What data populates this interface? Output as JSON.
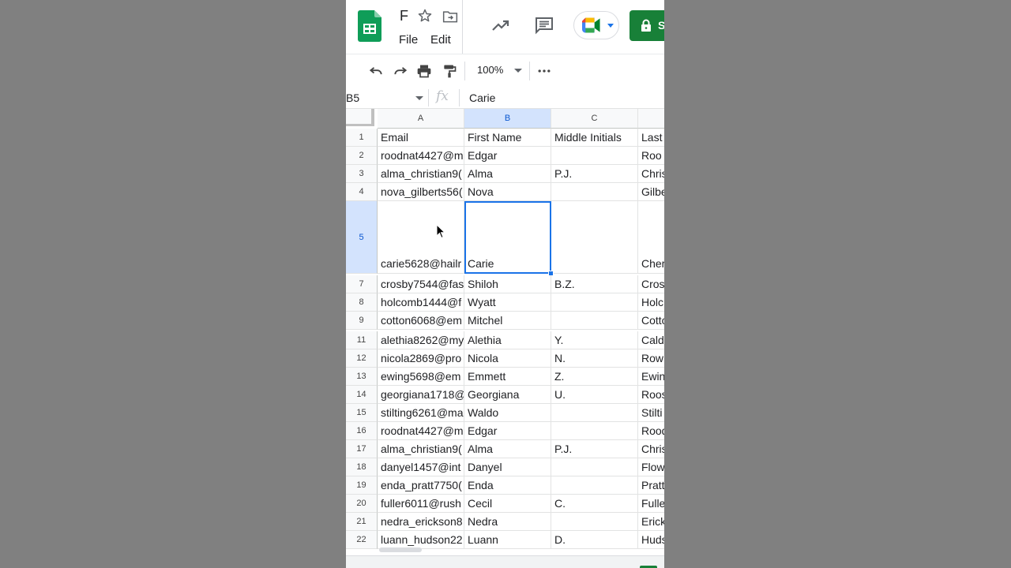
{
  "app": {
    "title_fragment": "F",
    "menus": [
      "File",
      "Edit"
    ],
    "share_label": "S",
    "colors": {
      "brand_green": "#188038",
      "selection_blue": "#1a73e8"
    }
  },
  "toolbar": {
    "zoom": "100%",
    "icons": [
      "undo-icon",
      "redo-icon",
      "print-icon",
      "paint-format-icon",
      "more-icon"
    ]
  },
  "formula_bar": {
    "cell_ref": "B5",
    "fx": "fx",
    "value": "Carie"
  },
  "grid": {
    "columns": [
      "A",
      "B",
      "C"
    ],
    "selected_column": "B",
    "selected_row": "5",
    "rows": [
      {
        "n": "1",
        "a": "Email",
        "b": "First Name",
        "c": "Middle Initials",
        "d": "Last"
      },
      {
        "n": "2",
        "a": "roodnat4427@m",
        "b": "Edgar",
        "c": "",
        "d": "Roo"
      },
      {
        "n": "3",
        "a": "alma_christian9(",
        "b": "Alma",
        "c": "P.J.",
        "d": "Chris"
      },
      {
        "n": "4",
        "a": "nova_gilberts56(",
        "b": "Nova",
        "c": "",
        "d": "Gilbe"
      },
      {
        "n": "5",
        "a": "carie5628@hailr",
        "b": "Carie",
        "c": "",
        "d": "Cher"
      },
      {
        "n": "7",
        "a": "crosby7544@fas",
        "b": "Shiloh",
        "c": "B.Z.",
        "d": "Cros"
      },
      {
        "n": "8",
        "a": "holcomb1444@f",
        "b": "Wyatt",
        "c": "",
        "d": "Holc"
      },
      {
        "n": "9",
        "a": "cotton6068@em",
        "b": "Mitchel",
        "c": "",
        "d": "Cotto"
      },
      {
        "n": "11",
        "a": "alethia8262@my",
        "b": "Alethia",
        "c": "Y.",
        "d": "Cald"
      },
      {
        "n": "12",
        "a": "nicola2869@pro",
        "b": "Nicola",
        "c": "N.",
        "d": "Row"
      },
      {
        "n": "13",
        "a": "ewing5698@em",
        "b": "Emmett",
        "c": "Z.",
        "d": "Ewin"
      },
      {
        "n": "14",
        "a": "georgiana1718@",
        "b": "Georgiana",
        "c": "U.",
        "d": "Roos"
      },
      {
        "n": "15",
        "a": "stilting6261@ma",
        "b": "Waldo",
        "c": "",
        "d": "Stilti"
      },
      {
        "n": "16",
        "a": "roodnat4427@m",
        "b": "Edgar",
        "c": "",
        "d": "Rood"
      },
      {
        "n": "17",
        "a": "alma_christian9(",
        "b": "Alma",
        "c": "P.J.",
        "d": "Chris"
      },
      {
        "n": "18",
        "a": "danyel1457@int",
        "b": "Danyel",
        "c": "",
        "d": "Flow"
      },
      {
        "n": "19",
        "a": "enda_pratt7750(",
        "b": "Enda",
        "c": "",
        "d": "Pratt"
      },
      {
        "n": "20",
        "a": "fuller6011@rush",
        "b": "Cecil",
        "c": "C.",
        "d": "Fulle"
      },
      {
        "n": "21",
        "a": "nedra_erickson8",
        "b": "Nedra",
        "c": "",
        "d": "Erick"
      },
      {
        "n": "22",
        "a": "luann_hudson22",
        "b": "Luann",
        "c": "D.",
        "d": "Huds"
      }
    ]
  }
}
